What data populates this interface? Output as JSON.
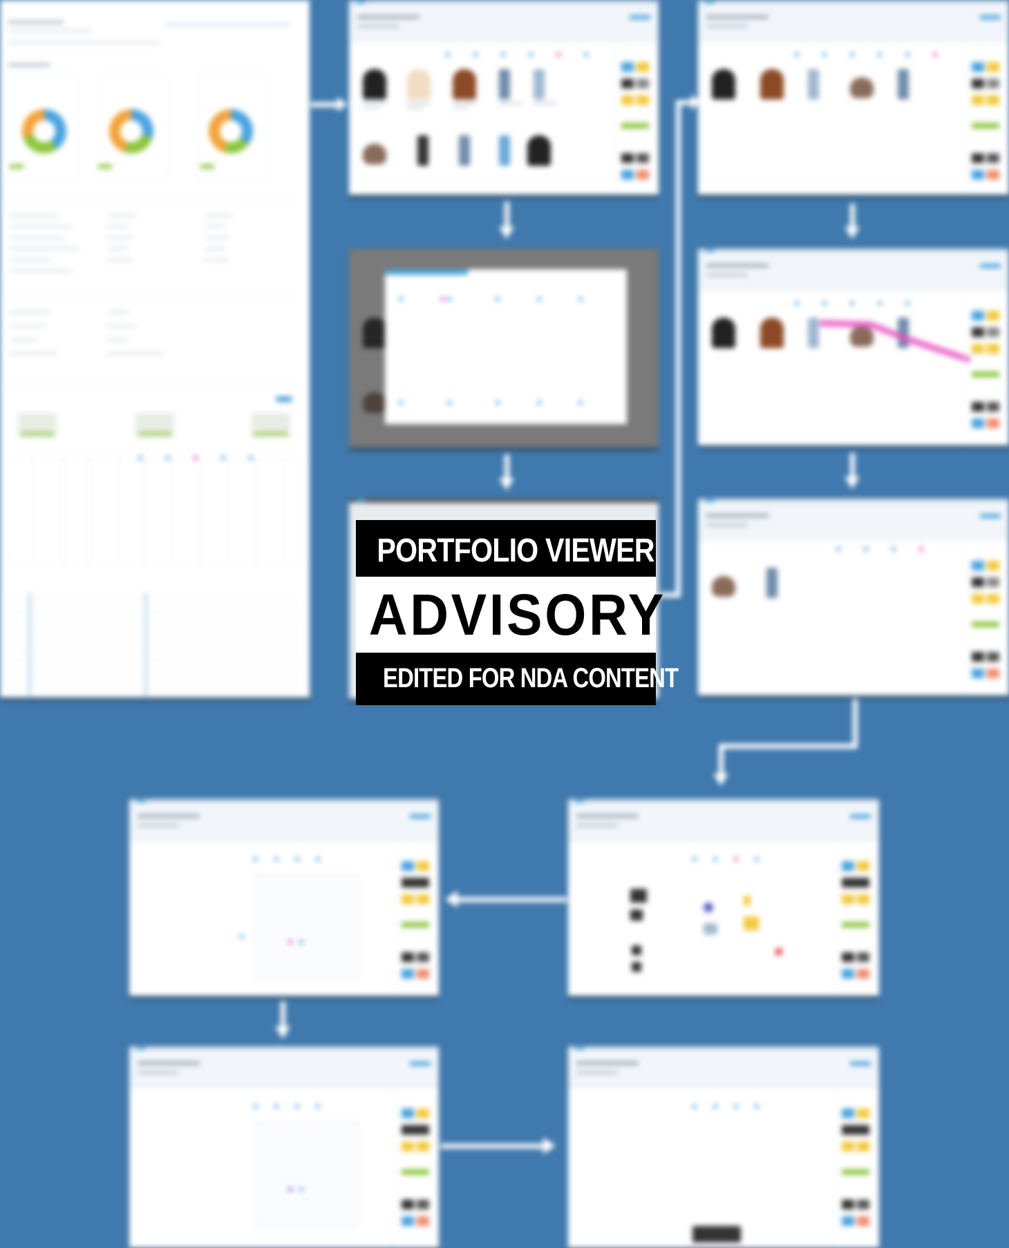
{
  "advisory": {
    "line1": "PORTFOLIO VIEWER",
    "line2": "ADVISORY",
    "line3": "EDITED FOR NDA CONTENT"
  },
  "colors": {
    "background": "#4079ad",
    "connector": "#ffffff",
    "accent": "#4aa3df",
    "highlight": "#e84fc1",
    "badge": "#000000"
  },
  "screens": [
    {
      "kind": "dashboard-report"
    },
    {
      "kind": "product-grid"
    },
    {
      "kind": "product-grid-modal"
    },
    {
      "kind": "product-grid-filtered"
    },
    {
      "kind": "product-grid-drag-gesture"
    },
    {
      "kind": "product-grid-sparse"
    },
    {
      "kind": "product-detail-popover"
    },
    {
      "kind": "product-scatter-grid"
    },
    {
      "kind": "product-detail-popover-selected"
    },
    {
      "kind": "product-empty-grid"
    }
  ]
}
